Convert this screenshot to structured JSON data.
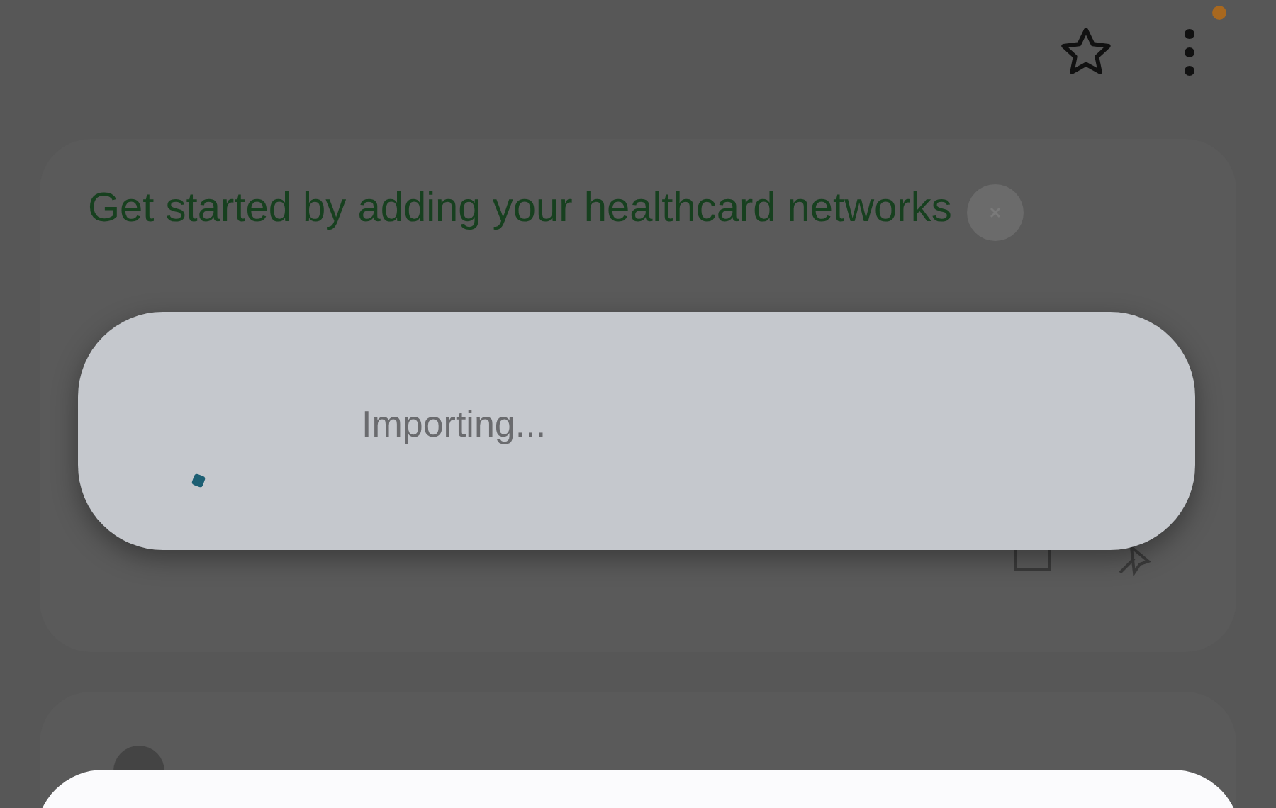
{
  "top_bar": {
    "menu_badge": true
  },
  "cards": [
    {
      "kind": "prompt",
      "title": "Get started by adding your healthcard networks"
    },
    {
      "kind": "contact"
    }
  ],
  "dialog": {
    "message": "Importing..."
  }
}
